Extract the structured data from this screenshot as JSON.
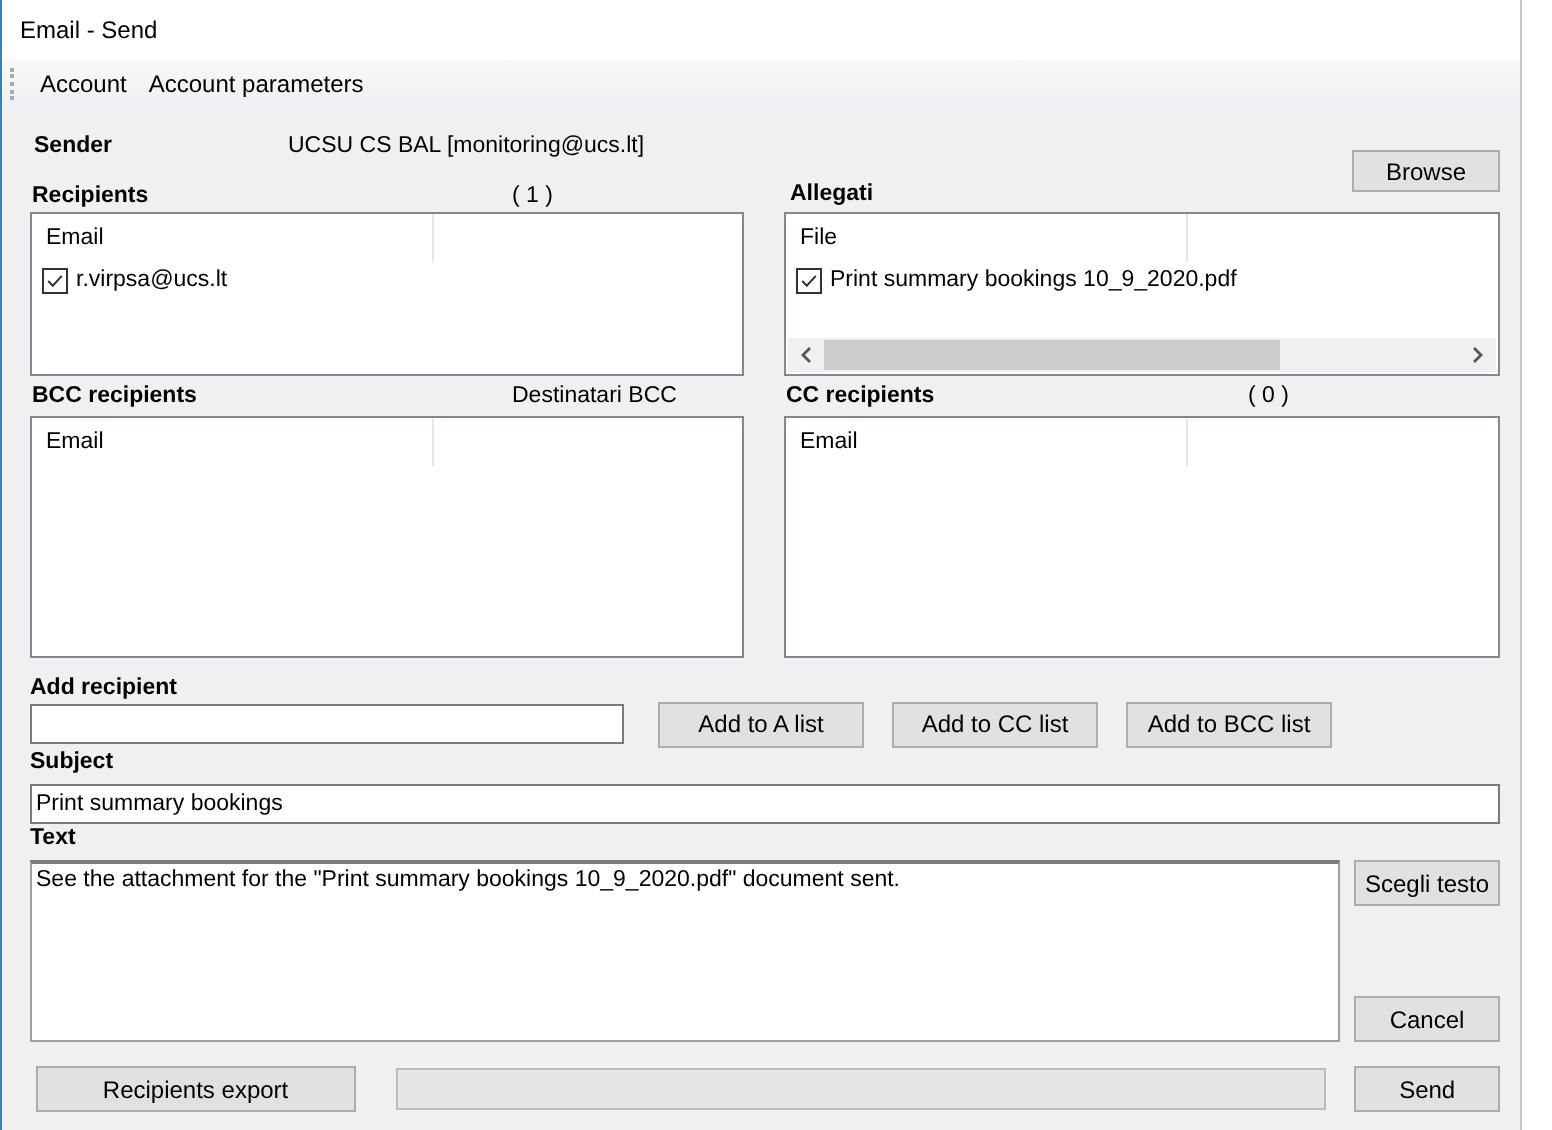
{
  "window": {
    "title": "Email - Send"
  },
  "menu": [
    {
      "label": "Account"
    },
    {
      "label": "Account parameters"
    }
  ],
  "sender": {
    "label": "Sender",
    "value": "UCSU CS BAL [monitoring@ucs.lt]"
  },
  "recipients": {
    "label": "Recipients",
    "count": "( 1 )",
    "columns": [
      "Email"
    ],
    "rows": [
      {
        "value": "r.virpsa@ucs.lt",
        "checked": true
      }
    ]
  },
  "attachments": {
    "label": "Allegati",
    "browse_button": "Browse",
    "columns": [
      "File"
    ],
    "rows": [
      {
        "value": "Print summary bookings 10_9_2020.pdf",
        "checked": true
      }
    ]
  },
  "bcc_recipients": {
    "label": "BCC recipients",
    "caption": "Destinatari BCC",
    "columns": [
      "Email"
    ]
  },
  "cc_recipients": {
    "label": "CC recipients",
    "count": "( 0 )",
    "columns": [
      "Email"
    ]
  },
  "add_recipient": {
    "label": "Add recipient",
    "buttons": [
      "Add to A list",
      "Add to CC list",
      "Add to BCC list"
    ]
  },
  "subject": {
    "label": "Subject",
    "value": "Print summary bookings"
  },
  "text": {
    "label": "Text",
    "value": "See the attachment for the \"Print summary bookings 10_9_2020.pdf\" document sent.",
    "choose_button": "Scegli testo"
  },
  "buttons": {
    "cancel": "Cancel",
    "export": "Recipients export",
    "send": "Send"
  },
  "progress": {
    "level": 0
  }
}
